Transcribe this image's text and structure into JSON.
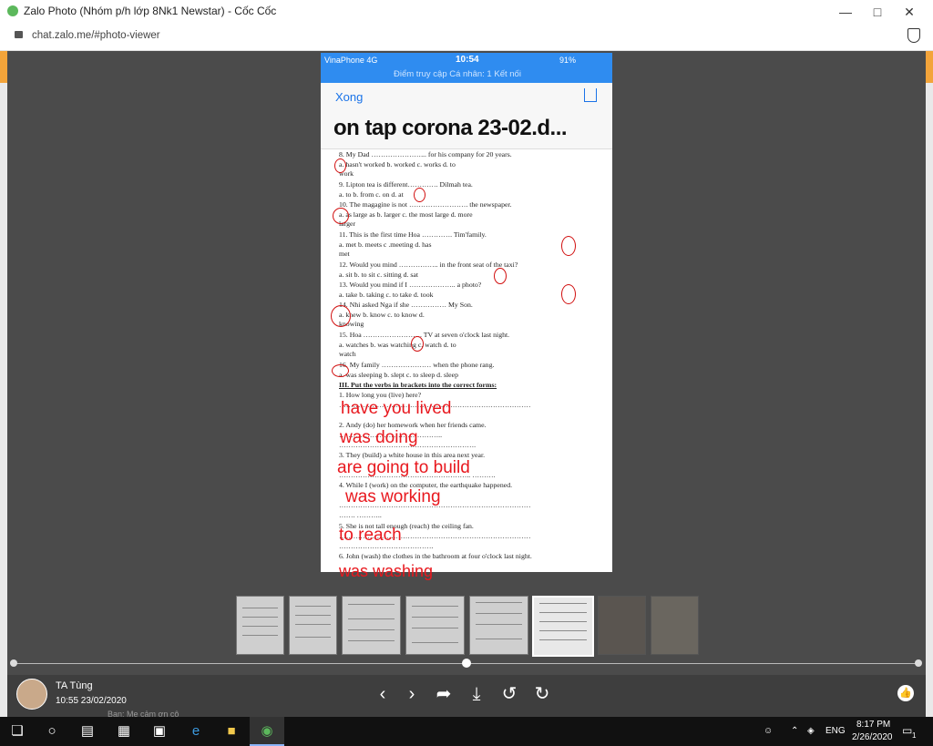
{
  "window": {
    "title": "Zalo Photo (Nhóm p/h lớp 8Nk1 Newstar) - Cốc Cốc",
    "url": "chat.zalo.me/#photo-viewer"
  },
  "phone": {
    "carrier": "VinaPhone  4G",
    "time": "10:54",
    "battery": "91%",
    "hotspot": "Điểm truy cập Cá nhân: 1 Kết nối",
    "done_label": "Xong",
    "doc_title": "on tap corona 23-02.d..."
  },
  "document": {
    "lines": [
      "8. My Dad …………………... for his company for 20 years.",
      "a. hasn't worked          b. worked                c. works                  d. to",
      "work",
      "9. Lipton tea is different…………. Dilmah tea.",
      "a. to                         b. from                    c. on                         d. at",
      "10. The magagine is not ……………………. the newspaper.",
      "a. as large as              b. larger                 c. the most large       d. more",
      "larger",
      "11. This is the first time Hoa …………. Tim'family.",
      "a. met                       b. meets                  c .meeting                d. has",
      "met",
      "12. Would you mind …………….. in the front seat of the taxi?",
      "a. sit                         b. to sit                   c. sitting                   d. sat",
      "13. Would you mind if I ……………….. a photo?",
      "a. take                      b. taking                  c. to take                  d. took",
      "14. Nhi asked Nga if she …………… My Son.",
      "a. knew                     b. know                   c. to know                d.",
      "knowing",
      "15. Hoa ……………………. TV at seven o'clock last night.",
      "a. watches                 b. was watching        c. watch                    d. to",
      "watch",
      "16. My family ………………… when the phone rang.",
      "a. was sleeping           b. slept                    c. to sleep                 d. sleep",
      "III. Put the verbs in brackets into the correct forms:",
      "1. How long you (live) here?",
      "………………………………………………………………………",
      "2. Andy (do) her homework when her friends came.",
      "……………………………………..",
      "………………………………………………….",
      "3. They (build) a white house in this area next year.",
      "……………………………………………….. ……….",
      "4. While I (work) on the computer, the earthquake happened.",
      "………………………………………………………………………",
      "……. ………..",
      "5. She is not tall enough (reach) the ceiling fan.",
      "………………………………………………………………………",
      "………………………………….",
      "6. John (wash) the clothes in the bathroom at four o'clock last night."
    ],
    "handwritten": [
      "have you lived",
      "was doing",
      "are going to build",
      "was working",
      "to reach",
      "was washing"
    ]
  },
  "uploader": {
    "name": "TA Tùng",
    "time": "10:55 23/02/2020",
    "chat_preview": "Bạn: Mẹ cảm ơn cô"
  },
  "taskbar": {
    "lang": "ENG",
    "time": "8:17 PM",
    "date": "2/26/2020",
    "notif_count": "1"
  },
  "colors": {
    "accent": "#2f8cf0",
    "handwriting": "#e8181e",
    "viewer_bg": "#4b4b4b"
  }
}
